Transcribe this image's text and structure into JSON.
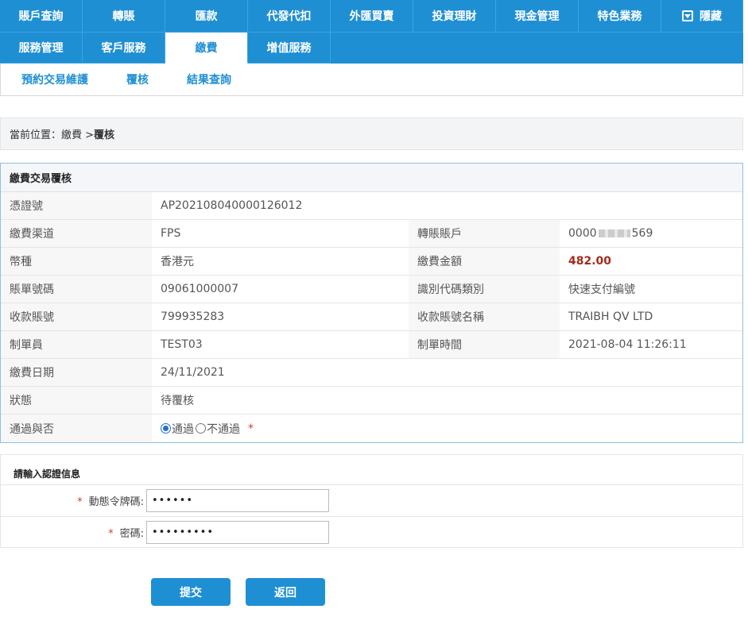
{
  "nav": {
    "row1": [
      "賬戶查詢",
      "轉賬",
      "匯款",
      "代發代扣",
      "外匯買賣",
      "投資理財",
      "現金管理",
      "特色業務"
    ],
    "hide_label": "隱藏",
    "row2": [
      "服務管理",
      "客戶服務",
      "繳費",
      "增值服務"
    ]
  },
  "subnav": [
    "預約交易維護",
    "覆核",
    "結果查詢"
  ],
  "breadcrumb": {
    "prefix": "當前位置：繳費 > ",
    "current": "覆核"
  },
  "detail": {
    "title": "繳費交易覆核",
    "voucher_label": "憑證號",
    "voucher": "AP202108040000126012",
    "channel_label": "繳費渠道",
    "channel": "FPS",
    "account_label": "轉賬賬戶",
    "account_prefix": "0000",
    "account_suffix": "569",
    "currency_label": "幣種",
    "currency": "香港元",
    "amount_label": "繳費金額",
    "amount": "482.00",
    "bill_label": "賬單號碼",
    "bill": "09061000007",
    "id_type_label": "識別代碼類別",
    "id_type": "快速支付編號",
    "payee_acct_label": "收款賬號",
    "payee_acct": "799935283",
    "payee_name_label": "收款賬號名稱",
    "payee_name": "TRAIBH QV LTD",
    "maker_label": "制單員",
    "maker": "TEST03",
    "make_time_label": "制單時間",
    "make_time": "2021-08-04 11:26:11",
    "pay_date_label": "繳費日期",
    "pay_date": "24/11/2021",
    "status_label": "狀態",
    "status": "待覆核",
    "approve_label": "通過與否",
    "approve_yes": "通過",
    "approve_no": "不通過",
    "required_mark": "*"
  },
  "auth": {
    "title": "請輸入認證信息",
    "token_label": "動態令牌碼:",
    "token_value": "••••••",
    "password_label": "密碼:",
    "password_value": "•••••••••",
    "required_mark": "*"
  },
  "buttons": {
    "submit": "提交",
    "back": "返回"
  }
}
